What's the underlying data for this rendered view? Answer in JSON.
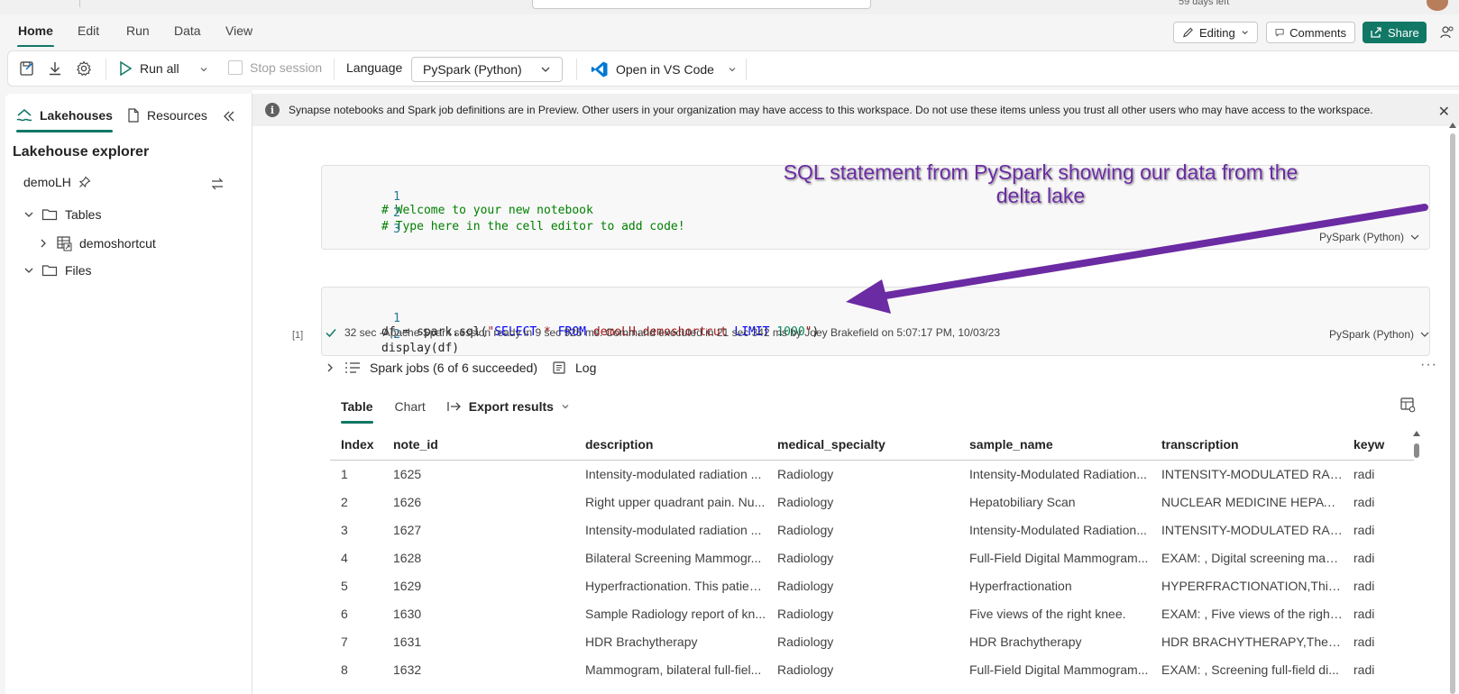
{
  "topbar": {
    "trial_text": "59 days left"
  },
  "ribbon": {
    "tabs": [
      "Home",
      "Edit",
      "Run",
      "Data",
      "View"
    ],
    "editing_label": "Editing",
    "comments_label": "Comments",
    "share_label": "Share"
  },
  "toolbar": {
    "run_all": "Run all",
    "stop_session": "Stop session",
    "language_label": "Language",
    "language_value": "PySpark (Python)",
    "open_vscode": "Open in VS Code"
  },
  "left_pane": {
    "tab_lakehouses": "Lakehouses",
    "tab_resources": "Resources",
    "title": "Lakehouse explorer",
    "lakehouse_name": "demoLH",
    "tables_label": "Tables",
    "table_item": "demoshortcut",
    "files_label": "Files"
  },
  "infobar": {
    "message": "Synapse notebooks and Spark job definitions are in Preview. Other users in your organization may have access to this workspace. Do not use these items unless you trust all other users who may have access to the workspace."
  },
  "cell1": {
    "line_numbers": [
      "1",
      "2",
      "3"
    ],
    "lines": [
      "# Welcome to your new notebook",
      "# Type here in the cell editor to add code!",
      ""
    ],
    "language": "PySpark (Python)"
  },
  "cell2": {
    "line_numbers": [
      "1",
      "2"
    ],
    "line1_a": "df = spark.sql(",
    "line1_str_a": "\"",
    "line1_kw1": "SELECT",
    "line1_mid1": " * ",
    "line1_kw2": "FROM",
    "line1_mid2": " demoLH.demoshortcut ",
    "line1_kw3": "LIMIT",
    "line1_num": " 1000",
    "line1_str_b": "\"",
    "line1_end": ")",
    "line2": "display(df)",
    "language": "PySpark (Python)",
    "exec_count": "[1]",
    "exec_summary": "32 sec -Apache Spark session ready in 9 sec 925 ms. Command executed in 21 sec 342 ms by Joey Brakefield on 5:07:17 PM, 10/03/23"
  },
  "annotation": {
    "text": "SQL statement from PySpark showing our data from the delta lake",
    "color": "#6b2ba3"
  },
  "output": {
    "spark_jobs": "Spark jobs (6 of 6 succeeded)",
    "log": "Log",
    "tabs": [
      "Table",
      "Chart"
    ],
    "export": "Export results"
  },
  "table": {
    "columns": [
      "Index",
      "note_id",
      "description",
      "medical_specialty",
      "sample_name",
      "transcription",
      "keyw"
    ],
    "rows": [
      [
        "1",
        "1625",
        "Intensity-modulated radiation ...",
        "Radiology",
        "Intensity-Modulated Radiation...",
        "INTENSITY-MODULATED RADI...",
        "radi"
      ],
      [
        "2",
        "1626",
        "Right upper quadrant pain. Nu...",
        "Radiology",
        "Hepatobiliary Scan",
        "NUCLEAR MEDICINE HEPATOB...",
        "radi"
      ],
      [
        "3",
        "1627",
        "Intensity-modulated radiation ...",
        "Radiology",
        "Intensity-Modulated Radiation...",
        "INTENSITY-MODULATED RADI...",
        "radi"
      ],
      [
        "4",
        "1628",
        "Bilateral Screening Mammogr...",
        "Radiology",
        "Full-Field Digital Mammogram...",
        "EXAM: , Digital screening mam...",
        "radi"
      ],
      [
        "5",
        "1629",
        "Hyperfractionation. This patien...",
        "Radiology",
        "Hyperfractionation",
        "HYPERFRACTIONATION,This p...",
        "radi"
      ],
      [
        "6",
        "1630",
        "Sample Radiology report of kn...",
        "Radiology",
        "Five views of the right knee.",
        "EXAM: , Five views of the right ...",
        "radi"
      ],
      [
        "7",
        "1631",
        "HDR Brachytherapy",
        "Radiology",
        "HDR Brachytherapy",
        "HDR BRACHYTHERAPY,The int...",
        "radi"
      ],
      [
        "8",
        "1632",
        "Mammogram, bilateral full-fiel...",
        "Radiology",
        "Full-Field Digital Mammogram...",
        "EXAM: , Screening full-field di...",
        "radi"
      ]
    ]
  },
  "colors": {
    "accent": "#117865",
    "vscode_blue": "#0078d4",
    "run_green": "#117865"
  }
}
